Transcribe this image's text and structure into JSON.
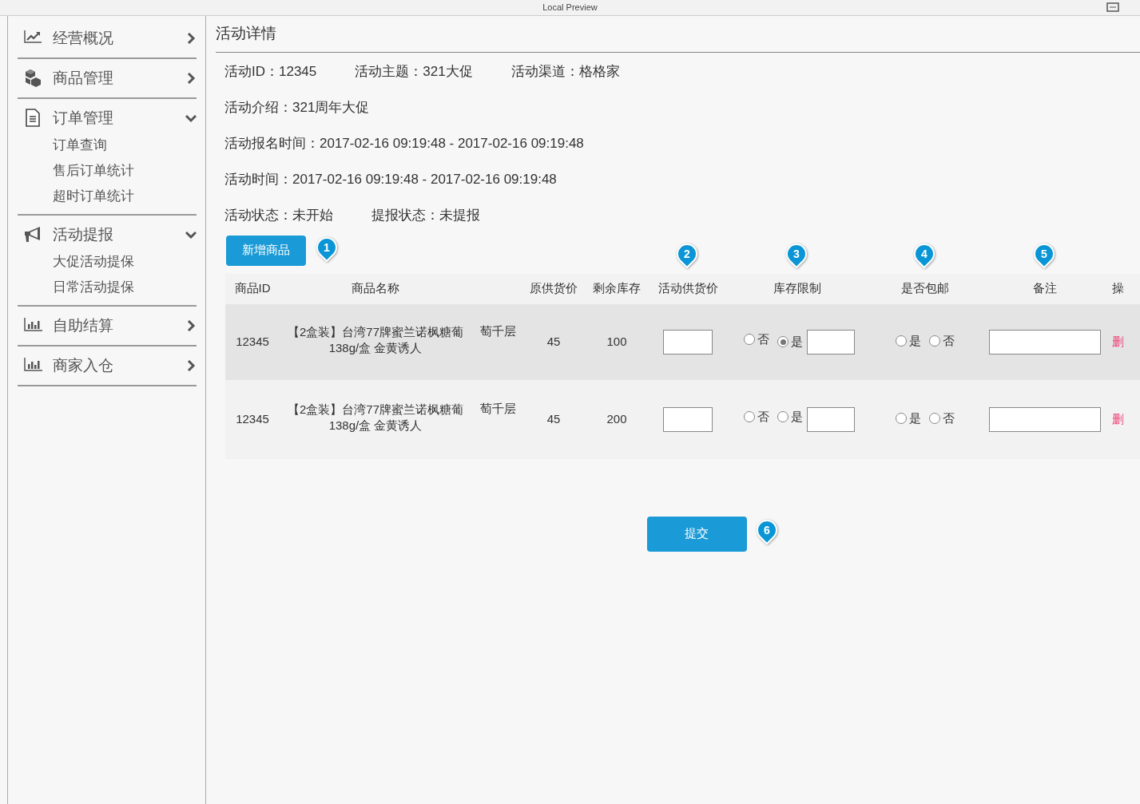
{
  "window": {
    "title": "Local Preview"
  },
  "sidebar": {
    "items": [
      {
        "label": "经营概况",
        "kind": "line-chart",
        "expanded": false
      },
      {
        "label": "商品管理",
        "kind": "cubes",
        "expanded": false
      },
      {
        "label": "订单管理",
        "kind": "document",
        "expanded": true,
        "children": [
          {
            "label": "订单查询"
          },
          {
            "label": "售后订单统计"
          },
          {
            "label": "超时订单统计"
          }
        ]
      },
      {
        "label": "活动提报",
        "kind": "megaphone",
        "expanded": true,
        "children": [
          {
            "label": "大促活动提保"
          },
          {
            "label": "日常活动提保"
          }
        ]
      },
      {
        "label": "自助结算",
        "kind": "bar-chart",
        "expanded": false
      },
      {
        "label": "商家入仓",
        "kind": "bar-chart",
        "expanded": false
      }
    ]
  },
  "page_title": "活动详情",
  "info_rows": [
    [
      "活动ID：12345",
      "活动主题：321大促",
      "活动渠道：格格家"
    ],
    [
      "活动介绍：321周年大促"
    ],
    [
      "活动报名时间：2017-02-16 09:19:48 - 2017-02-16 09:19:48"
    ],
    [
      "活动时间：2017-02-16 09:19:48 - 2017-02-16 09:19:48"
    ],
    [
      "活动状态：未开始",
      "提报状态：未提报"
    ]
  ],
  "add_button": {
    "label": "新增商品",
    "pin": "1"
  },
  "table": {
    "columns": [
      {
        "label": "商品ID"
      },
      {
        "label": "商品名称"
      },
      {},
      {
        "label": "原供货价"
      },
      {
        "label": "剩余库存"
      },
      {
        "label": "活动供货价",
        "pin": "2"
      },
      {
        "label": "库存限制",
        "pin": "3"
      },
      {
        "label": "是否包邮",
        "pin": "4"
      },
      {
        "label": "备注",
        "pin": "5"
      },
      {
        "label": "操"
      }
    ],
    "rows": [
      {
        "id": "12345",
        "name_lines": [
          "【2盒装】台湾77牌蜜兰诺枫糖葡",
          "138g/盒 金黄诱人"
        ],
        "column_3": "萄千层",
        "price": "45",
        "stock": "100",
        "stock_limit": [
          {
            "label": "否",
            "selected": false
          },
          {
            "label": "是",
            "selected": true
          }
        ],
        "free_shipping": [
          {
            "label": "是",
            "selected": false
          },
          {
            "label": "否",
            "selected": false
          }
        ],
        "action": "删"
      },
      {
        "id": "12345",
        "name_lines": [
          "【2盒装】台湾77牌蜜兰诺枫糖葡",
          "138g/盒 金黄诱人"
        ],
        "column_3": "萄千层",
        "price": "45",
        "stock": "200",
        "stock_limit": [
          {
            "label": "否",
            "selected": false
          },
          {
            "label": "是",
            "selected": false
          }
        ],
        "free_shipping": [
          {
            "label": "是",
            "selected": false
          },
          {
            "label": "否",
            "selected": false
          }
        ],
        "action": "删"
      }
    ]
  },
  "submit_button": {
    "label": "提交",
    "pin": "6"
  }
}
